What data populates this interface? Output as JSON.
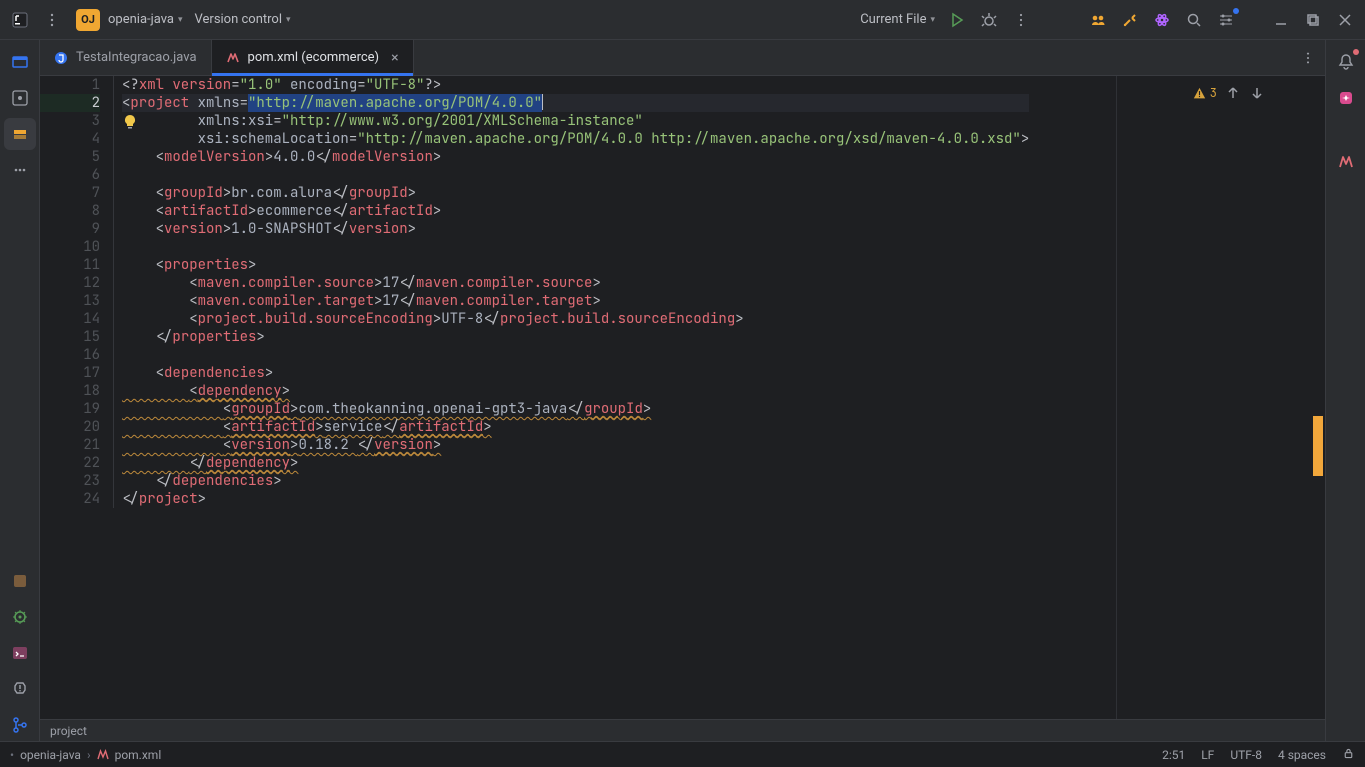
{
  "titlebar": {
    "project_badge": "OJ",
    "project_name": "openia-java",
    "vcs_label": "Version control",
    "run_config": "Current File"
  },
  "tabs": {
    "items": [
      {
        "label": "TestaIntegracao.java",
        "active": false,
        "kind": "java"
      },
      {
        "label": "pom.xml (ecommerce)",
        "active": true,
        "kind": "maven"
      }
    ]
  },
  "editor": {
    "warnings_count": "3",
    "lines": [
      {
        "n": 1,
        "segs": [
          {
            "t": "<?",
            "c": "punc"
          },
          {
            "t": "xml version",
            "c": "tag"
          },
          {
            "t": "=",
            "c": "punc"
          },
          {
            "t": "\"1.0\"",
            "c": "str"
          },
          {
            "t": " ",
            "c": "punc"
          },
          {
            "t": "encoding",
            "c": "attr"
          },
          {
            "t": "=",
            "c": "punc"
          },
          {
            "t": "\"UTF-8\"",
            "c": "str"
          },
          {
            "t": "?>",
            "c": "punc"
          }
        ]
      },
      {
        "n": 2,
        "cursor": true,
        "segs": [
          {
            "t": "<",
            "c": "punc"
          },
          {
            "t": "project",
            "c": "tag"
          },
          {
            "t": " ",
            "c": "punc"
          },
          {
            "t": "xmlns",
            "c": "attr"
          },
          {
            "t": "=",
            "c": "punc"
          },
          {
            "t": "\"http://maven.apache.org/POM/4.0.0\"",
            "c": "str",
            "sel": true
          }
        ]
      },
      {
        "n": 3,
        "indent": 9,
        "segs": [
          {
            "t": "xmlns:xsi",
            "c": "attr"
          },
          {
            "t": "=",
            "c": "punc"
          },
          {
            "t": "\"http://www.w3.org/2001/XMLSchema-instance\"",
            "c": "str"
          }
        ]
      },
      {
        "n": 4,
        "indent": 9,
        "segs": [
          {
            "t": "xsi:schemaLocation",
            "c": "attr"
          },
          {
            "t": "=",
            "c": "punc"
          },
          {
            "t": "\"http://maven.apache.org/POM/4.0.0 http://maven.apache.org/xsd/maven-4.0.0.xsd\"",
            "c": "str"
          },
          {
            "t": ">",
            "c": "punc"
          }
        ]
      },
      {
        "n": 5,
        "indent": 4,
        "segs": [
          {
            "t": "<",
            "c": "punc"
          },
          {
            "t": "modelVersion",
            "c": "tag"
          },
          {
            "t": ">",
            "c": "punc"
          },
          {
            "t": "4.0.0",
            "c": "attr"
          },
          {
            "t": "</",
            "c": "punc"
          },
          {
            "t": "modelVersion",
            "c": "tag"
          },
          {
            "t": ">",
            "c": "punc"
          }
        ]
      },
      {
        "n": 6,
        "segs": []
      },
      {
        "n": 7,
        "indent": 4,
        "segs": [
          {
            "t": "<",
            "c": "punc"
          },
          {
            "t": "groupId",
            "c": "tag"
          },
          {
            "t": ">",
            "c": "punc"
          },
          {
            "t": "br.com.alura",
            "c": "attr"
          },
          {
            "t": "</",
            "c": "punc"
          },
          {
            "t": "groupId",
            "c": "tag"
          },
          {
            "t": ">",
            "c": "punc"
          }
        ]
      },
      {
        "n": 8,
        "indent": 4,
        "segs": [
          {
            "t": "<",
            "c": "punc"
          },
          {
            "t": "artifactId",
            "c": "tag"
          },
          {
            "t": ">",
            "c": "punc"
          },
          {
            "t": "ecommerce",
            "c": "attr"
          },
          {
            "t": "</",
            "c": "punc"
          },
          {
            "t": "artifactId",
            "c": "tag"
          },
          {
            "t": ">",
            "c": "punc"
          }
        ]
      },
      {
        "n": 9,
        "indent": 4,
        "segs": [
          {
            "t": "<",
            "c": "punc"
          },
          {
            "t": "version",
            "c": "tag"
          },
          {
            "t": ">",
            "c": "punc"
          },
          {
            "t": "1.0-SNAPSHOT",
            "c": "attr"
          },
          {
            "t": "</",
            "c": "punc"
          },
          {
            "t": "version",
            "c": "tag"
          },
          {
            "t": ">",
            "c": "punc"
          }
        ]
      },
      {
        "n": 10,
        "segs": []
      },
      {
        "n": 11,
        "indent": 4,
        "segs": [
          {
            "t": "<",
            "c": "punc"
          },
          {
            "t": "properties",
            "c": "tag"
          },
          {
            "t": ">",
            "c": "punc"
          }
        ]
      },
      {
        "n": 12,
        "indent": 8,
        "segs": [
          {
            "t": "<",
            "c": "punc"
          },
          {
            "t": "maven.compiler.source",
            "c": "tag"
          },
          {
            "t": ">",
            "c": "punc"
          },
          {
            "t": "17",
            "c": "attr"
          },
          {
            "t": "</",
            "c": "punc"
          },
          {
            "t": "maven.compiler.source",
            "c": "tag"
          },
          {
            "t": ">",
            "c": "punc"
          }
        ]
      },
      {
        "n": 13,
        "indent": 8,
        "segs": [
          {
            "t": "<",
            "c": "punc"
          },
          {
            "t": "maven.compiler.target",
            "c": "tag"
          },
          {
            "t": ">",
            "c": "punc"
          },
          {
            "t": "17",
            "c": "attr"
          },
          {
            "t": "</",
            "c": "punc"
          },
          {
            "t": "maven.compiler.target",
            "c": "tag"
          },
          {
            "t": ">",
            "c": "punc"
          }
        ]
      },
      {
        "n": 14,
        "indent": 8,
        "segs": [
          {
            "t": "<",
            "c": "punc"
          },
          {
            "t": "project.build.sourceEncoding",
            "c": "tag"
          },
          {
            "t": ">",
            "c": "punc"
          },
          {
            "t": "UTF-8",
            "c": "attr"
          },
          {
            "t": "</",
            "c": "punc"
          },
          {
            "t": "project.build.sourceEncoding",
            "c": "tag"
          },
          {
            "t": ">",
            "c": "punc"
          }
        ]
      },
      {
        "n": 15,
        "indent": 4,
        "segs": [
          {
            "t": "</",
            "c": "punc"
          },
          {
            "t": "properties",
            "c": "tag"
          },
          {
            "t": ">",
            "c": "punc"
          }
        ]
      },
      {
        "n": 16,
        "segs": []
      },
      {
        "n": 17,
        "indent": 4,
        "segs": [
          {
            "t": "<",
            "c": "punc"
          },
          {
            "t": "dependencies",
            "c": "tag"
          },
          {
            "t": ">",
            "c": "punc"
          }
        ]
      },
      {
        "n": 18,
        "indent": 8,
        "squig": true,
        "segs": [
          {
            "t": "<",
            "c": "punc"
          },
          {
            "t": "dependency",
            "c": "tag",
            "u": true
          },
          {
            "t": ">",
            "c": "punc"
          }
        ]
      },
      {
        "n": 19,
        "indent": 12,
        "squig": true,
        "segs": [
          {
            "t": "<",
            "c": "punc"
          },
          {
            "t": "groupId",
            "c": "tag",
            "u": true
          },
          {
            "t": ">",
            "c": "punc"
          },
          {
            "t": "com.theokanning.openai-gpt3-java",
            "c": "attr"
          },
          {
            "t": "</",
            "c": "punc"
          },
          {
            "t": "groupId",
            "c": "tag",
            "u": true
          },
          {
            "t": ">",
            "c": "punc"
          }
        ]
      },
      {
        "n": 20,
        "indent": 12,
        "squig": true,
        "segs": [
          {
            "t": "<",
            "c": "punc"
          },
          {
            "t": "artifactId",
            "c": "tag",
            "u": true
          },
          {
            "t": ">",
            "c": "punc"
          },
          {
            "t": "service",
            "c": "attr"
          },
          {
            "t": "</",
            "c": "punc"
          },
          {
            "t": "artifactId",
            "c": "tag",
            "u": true
          },
          {
            "t": ">",
            "c": "punc"
          }
        ]
      },
      {
        "n": 21,
        "indent": 12,
        "squig": true,
        "segs": [
          {
            "t": "<",
            "c": "punc"
          },
          {
            "t": "version",
            "c": "tag",
            "u": true
          },
          {
            "t": ">",
            "c": "punc"
          },
          {
            "t": "0.18.2 ",
            "c": "attr"
          },
          {
            "t": "</",
            "c": "punc"
          },
          {
            "t": "version",
            "c": "tag",
            "u": true
          },
          {
            "t": ">",
            "c": "punc"
          }
        ]
      },
      {
        "n": 22,
        "indent": 8,
        "squig": true,
        "segs": [
          {
            "t": "</",
            "c": "punc"
          },
          {
            "t": "dependency",
            "c": "tag",
            "u": true
          },
          {
            "t": ">",
            "c": "punc"
          }
        ]
      },
      {
        "n": 23,
        "indent": 4,
        "segs": [
          {
            "t": "</",
            "c": "punc"
          },
          {
            "t": "dependencies",
            "c": "tag"
          },
          {
            "t": ">",
            "c": "punc"
          }
        ]
      },
      {
        "n": 24,
        "segs": [
          {
            "t": "</",
            "c": "punc"
          },
          {
            "t": "project",
            "c": "tag"
          },
          {
            "t": ">",
            "c": "punc"
          }
        ]
      }
    ]
  },
  "project_tool": {
    "label": "project"
  },
  "status": {
    "crumb_project": "openia-java",
    "crumb_file": "pom.xml",
    "caret": "2:51",
    "line_ending": "LF",
    "encoding": "UTF-8",
    "indent": "4 spaces"
  }
}
